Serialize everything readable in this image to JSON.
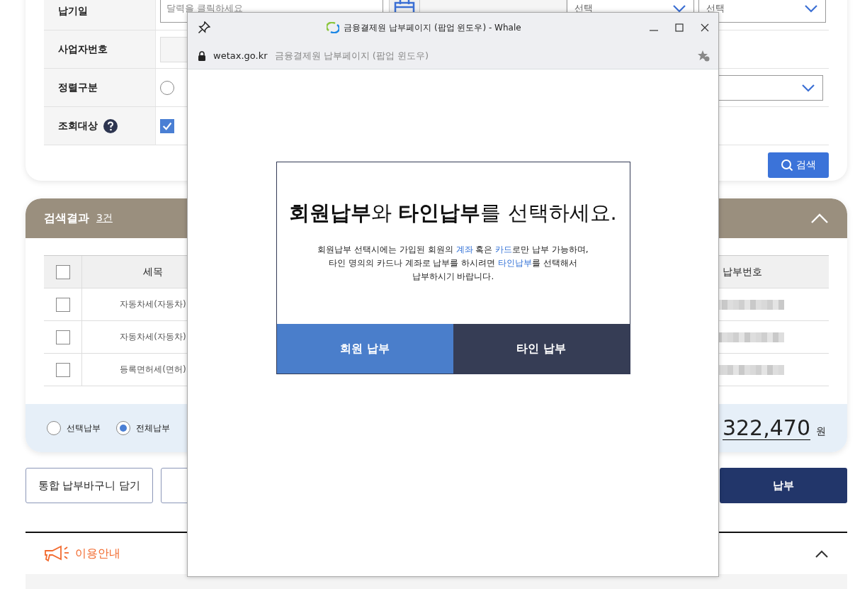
{
  "search_form": {
    "due_date": {
      "label": "납기일",
      "placeholder": "달력을 클릭하세요"
    },
    "business_number": {
      "label": "사업자번호"
    },
    "sort": {
      "label": "정렬구분",
      "options": [
        {
          "selected": false
        }
      ]
    },
    "target": {
      "label": "조회대상",
      "help": true,
      "options": [
        {
          "checked": true
        }
      ]
    },
    "region": {
      "selects": [
        "선택",
        "선택"
      ]
    },
    "search_button": "검색"
  },
  "results": {
    "title": "검색결과",
    "count": "3건",
    "expanded": true,
    "header_checked": false,
    "columns": [
      "세목",
      "납부번호"
    ],
    "rows": [
      {
        "tax_item": "자동차세(자동차)",
        "checked": false
      },
      {
        "tax_item": "자동차세(자동차)",
        "checked": false
      },
      {
        "tax_item": "등록면허세(면허)",
        "checked": false
      }
    ],
    "pay_options": [
      {
        "label": "선택납부",
        "selected": false
      },
      {
        "label": "전체납부",
        "selected": true
      }
    ],
    "total": "322,470",
    "currency": "원"
  },
  "buttons": [
    {
      "kind": "outline",
      "label": "통합 납부바구니 담기"
    },
    {
      "kind": "outline"
    },
    {
      "kind": "primary",
      "label": "납부"
    }
  ],
  "guide": {
    "title": "이용안내",
    "expanded": true
  },
  "popup": {
    "title": "금융결제원 납부페이지 (팝업 윈도우) - Whale",
    "url": "wetax.go.kr",
    "page_title": "금융결제원 납부페이지 (팝업 윈도우)",
    "heading": "**회원납부**와 **타인납부**를 선택하세요.",
    "description": [
      {
        "kind": "text",
        "text": "회원납부 선택시에는 가입된 회원의 "
      },
      {
        "kind": "link",
        "text": "계좌"
      },
      {
        "kind": "text",
        "text": " 혹은 "
      },
      {
        "kind": "link",
        "text": "카드"
      },
      {
        "kind": "text",
        "text": "로만 납부 가능하며,"
      },
      {
        "kind": "break"
      },
      {
        "kind": "text",
        "text": "타인 명의의 카드나 계좌로 납부를 하시려면 "
      },
      {
        "kind": "link",
        "text": "타인납부"
      },
      {
        "kind": "text",
        "text": "를 선택해서"
      },
      {
        "kind": "break"
      },
      {
        "kind": "text",
        "text": "납부하시기 바랍니다."
      }
    ],
    "choices": [
      {
        "kind": "primary",
        "label": "회원 납부"
      },
      {
        "kind": "secondary",
        "label": "타인 납부"
      }
    ]
  }
}
